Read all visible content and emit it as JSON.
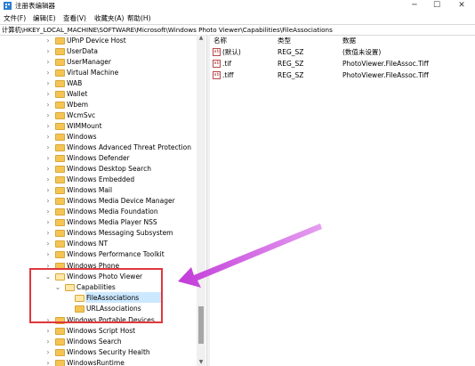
{
  "window": {
    "title": "注册表编辑器",
    "minimize_glyph": "─",
    "maximize_glyph": "☐",
    "close_glyph": "✕"
  },
  "menu": [
    "文件(F)",
    "编辑(E)",
    "查看(V)",
    "收藏夹(A)",
    "帮助(H)"
  ],
  "address": "计算机\\HKEY_LOCAL_MACHINE\\SOFTWARE\\Microsoft\\Windows Photo Viewer\\Capabilities\\FileAssociations",
  "tree": [
    {
      "label": "UPnP Device Host"
    },
    {
      "label": "UserData"
    },
    {
      "label": "UserManager"
    },
    {
      "label": "Virtual Machine"
    },
    {
      "label": "WAB"
    },
    {
      "label": "Wallet"
    },
    {
      "label": "Wbem"
    },
    {
      "label": "WcmSvc"
    },
    {
      "label": "WIMMount"
    },
    {
      "label": "Windows"
    },
    {
      "label": "Windows Advanced Threat Protection"
    },
    {
      "label": "Windows Defender"
    },
    {
      "label": "Windows Desktop Search"
    },
    {
      "label": "Windows Embedded"
    },
    {
      "label": "Windows Mail"
    },
    {
      "label": "Windows Media Device Manager"
    },
    {
      "label": "Windows Media Foundation"
    },
    {
      "label": "Windows Media Player NSS"
    },
    {
      "label": "Windows Messaging Subsystem"
    },
    {
      "label": "Windows NT"
    },
    {
      "label": "Windows Performance Toolkit"
    },
    {
      "label": "Windows Phone"
    },
    {
      "label": "Windows Photo Viewer"
    },
    {
      "label": "Capabilities"
    },
    {
      "label": "FileAssociations"
    },
    {
      "label": "URLAssociations"
    },
    {
      "label": "Windows Portable Devices"
    },
    {
      "label": "Windows Script Host"
    },
    {
      "label": "Windows Search"
    },
    {
      "label": "Windows Security Health"
    },
    {
      "label": "WindowsRuntime"
    }
  ],
  "values_header": {
    "name": "名称",
    "type": "类型",
    "data": "数据"
  },
  "values": [
    {
      "icon": "ab",
      "name": "(默认)",
      "type": "REG_SZ",
      "data": "(数值未设置)"
    },
    {
      "icon": "ab",
      "name": ".tif",
      "type": "REG_SZ",
      "data": "PhotoViewer.FileAssoc.Tiff"
    },
    {
      "icon": "ab",
      "name": ".tiff",
      "type": "REG_SZ",
      "data": "PhotoViewer.FileAssoc.Tiff"
    }
  ],
  "colors": {
    "selection": "#cce8ff",
    "annotation_red": "#e0373b",
    "annotation_arrow": "#c23bd9",
    "folder": "#f4c555"
  }
}
